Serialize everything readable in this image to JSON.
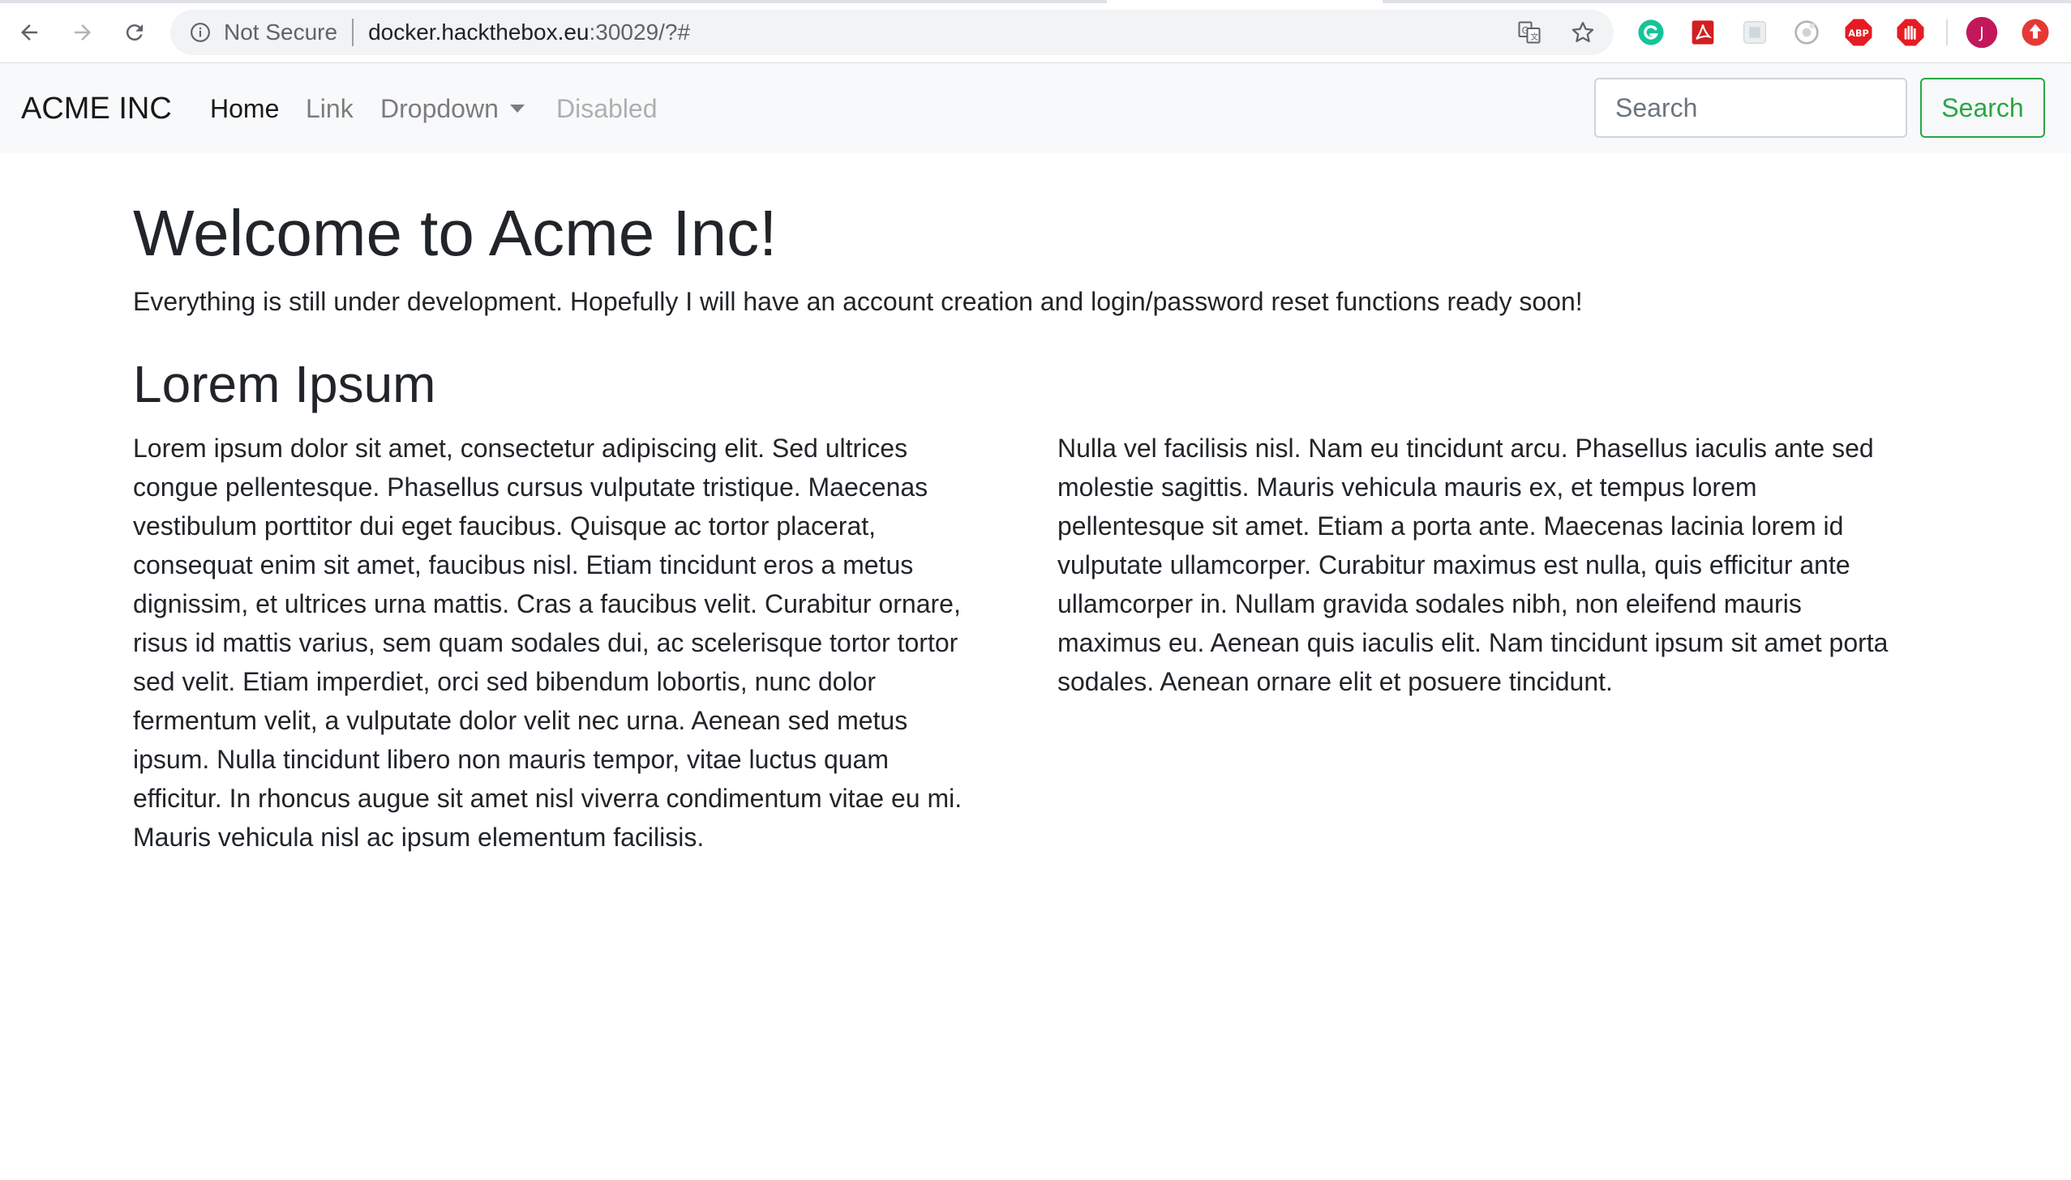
{
  "browser": {
    "security_label": "Not Secure",
    "url_host": "docker.hackthebox.eu",
    "url_rest": ":30029/?#",
    "icons": [
      "back-arrow-icon",
      "forward-arrow-icon",
      "reload-icon",
      "info-icon",
      "translate-icon",
      "star-icon",
      "grammarly-icon",
      "acrobat-icon",
      "extension-icon",
      "screencast-icon",
      "adblock-icon",
      "stop-icon",
      "profile-avatar",
      "update-icon"
    ],
    "profile_initial": "J",
    "adblock_label": "ABP"
  },
  "navbar": {
    "brand": "ACME INC",
    "links": [
      {
        "label": "Home",
        "state": "active"
      },
      {
        "label": "Link",
        "state": "normal"
      },
      {
        "label": "Dropdown",
        "state": "dropdown"
      },
      {
        "label": "Disabled",
        "state": "disabled"
      }
    ],
    "search_placeholder": "Search",
    "search_button": "Search",
    "colors": {
      "bg": "#f8f9fa",
      "success": "#28a745"
    }
  },
  "main": {
    "title": "Welcome to Acme Inc!",
    "lead": "Everything is still under development. Hopefully I will have an account creation and login/password reset functions ready soon!",
    "subtitle": "Lorem Ipsum",
    "paragraphs": [
      "Lorem ipsum dolor sit amet, consectetur adipiscing elit. Sed ultrices congue pellentesque. Phasellus cursus vulputate tristique. Maecenas vestibulum porttitor dui eget faucibus. Quisque ac tortor placerat, consequat enim sit amet, faucibus nisl. Etiam tincidunt eros a metus dignissim, et ultrices urna mattis. Cras a faucibus velit. Curabitur ornare, risus id mattis varius, sem quam sodales dui, ac scelerisque tortor tortor sed velit. Etiam imperdiet, orci sed bibendum lobortis, nunc dolor fermentum velit, a vulputate dolor velit nec urna. Aenean sed metus ipsum. Nulla tincidunt libero non mauris tempor, vitae luctus quam efficitur. In rhoncus augue sit amet nisl viverra condimentum vitae eu mi. Mauris vehicula nisl ac ipsum elementum facilisis.",
      "Nulla vel facilisis nisl. Nam eu tincidunt arcu. Phasellus iaculis ante sed molestie sagittis. Mauris vehicula mauris ex, et tempus lorem pellentesque sit amet. Etiam a porta ante. Maecenas lacinia lorem id vulputate ullamcorper. Curabitur maximus est nulla, quis efficitur ante ullamcorper in. Nullam gravida sodales nibh, non eleifend mauris maximus eu. Aenean quis iaculis elit. Nam tincidunt ipsum sit amet porta sodales. Aenean ornare elit et posuere tincidunt."
    ]
  }
}
